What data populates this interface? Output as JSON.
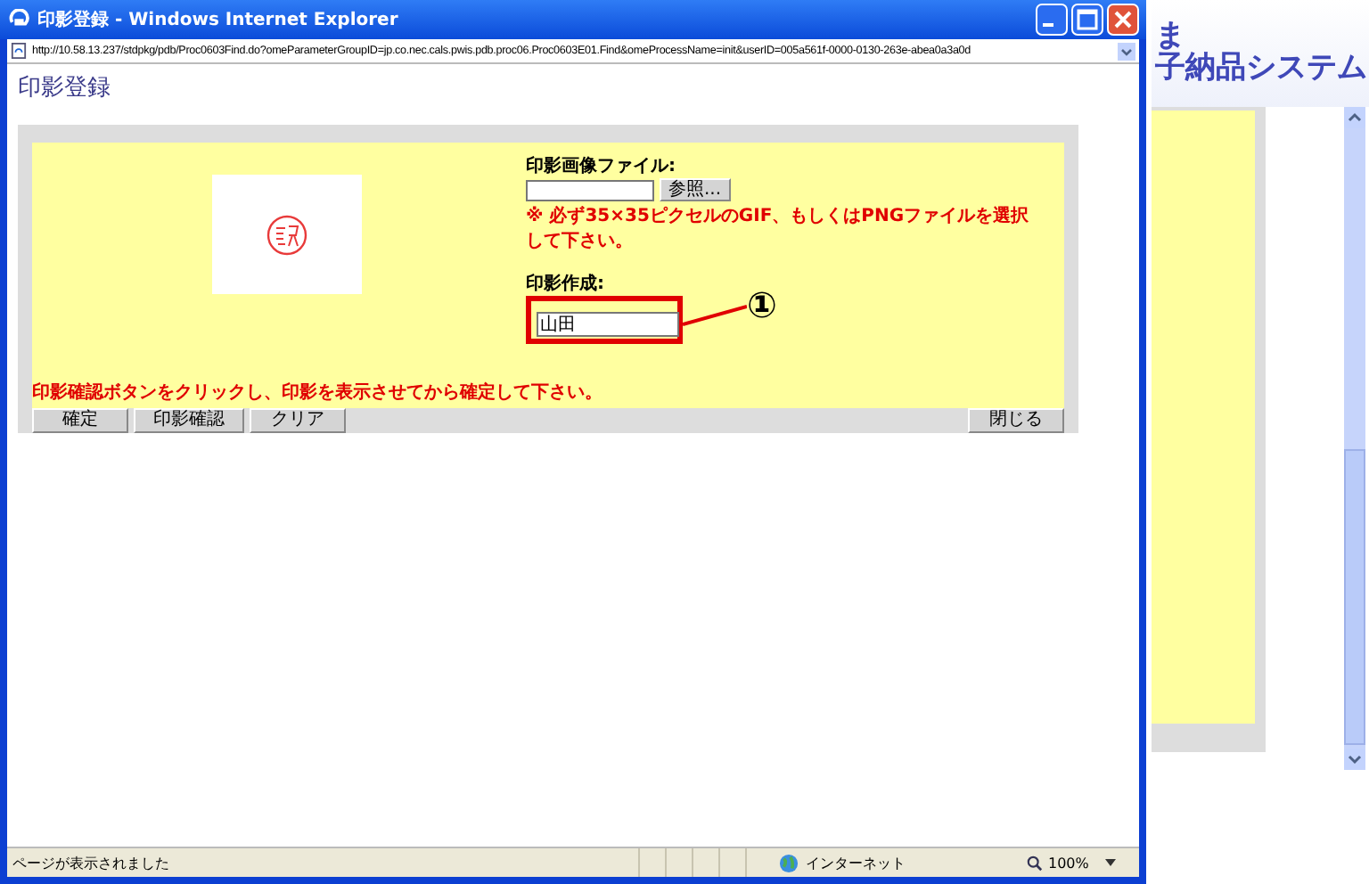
{
  "background_page": {
    "logo_lines": [
      "ま",
      "子納品システム"
    ]
  },
  "window": {
    "title": "印影登録 - Windows Internet Explorer",
    "address": "http://10.58.13.237/stdpkg/pdb/Proc0603Find.do?omeParameterGroupID=jp.co.nec.cals.pwis.pdb.proc06.Proc0603E01.Find&omeProcessName=init&userID=005a561f-0000-0130-263e-abea0a3a0d"
  },
  "page": {
    "heading": "印影登録",
    "file_label": "印影画像ファイル:",
    "browse_button": "参照...",
    "file_note": "※ 必ず35×35ピクセルのGIF、もしくはPNGファイルを選択して下さい。",
    "create_label": "印影作成:",
    "create_value": "山田",
    "instruction": "印影確認ボタンをクリックし、印影を表示させてから確定して下さい。",
    "buttons": [
      "確定",
      "印影確認",
      "クリア"
    ],
    "close_button": "閉じる"
  },
  "annotation": {
    "marker": "①"
  },
  "status_bar": {
    "message": "ページが表示されました",
    "zone": "インターネット",
    "zoom": "100%"
  }
}
